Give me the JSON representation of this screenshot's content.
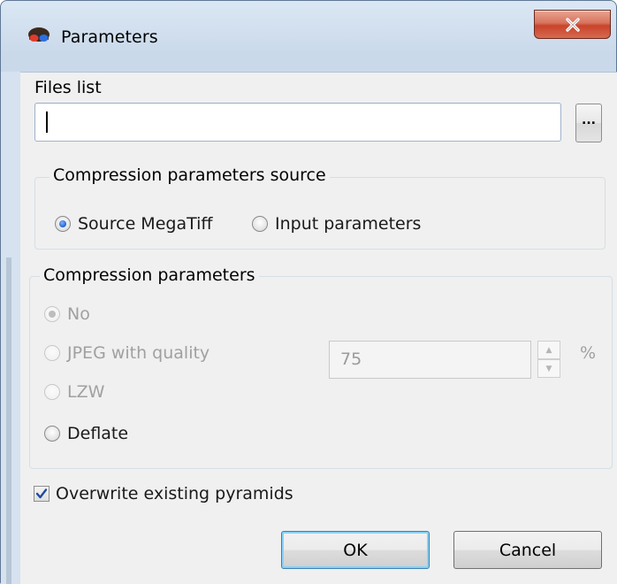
{
  "window": {
    "title": "Parameters",
    "app_icon": "3d-glasses-icon",
    "close_icon": "close-icon"
  },
  "files": {
    "label": "Files list",
    "value": "",
    "browse_label": "..."
  },
  "source_group": {
    "title": "Compression parameters source",
    "options": [
      {
        "label": "Source MegaTiff",
        "selected": true
      },
      {
        "label": "Input parameters",
        "selected": false
      }
    ]
  },
  "compression_group": {
    "title": "Compression parameters",
    "options": [
      {
        "label": "No",
        "selected": true,
        "enabled": false
      },
      {
        "label": "JPEG with quality",
        "selected": false,
        "enabled": false
      },
      {
        "label": "LZW",
        "selected": false,
        "enabled": false
      },
      {
        "label": "Deflate",
        "selected": false,
        "enabled": true
      }
    ],
    "quality_value": "75",
    "quality_unit": "%"
  },
  "overwrite": {
    "label": "Overwrite existing pyramids",
    "checked": true
  },
  "buttons": {
    "ok": "OK",
    "cancel": "Cancel"
  },
  "colors": {
    "titlebar": "#cad9ea",
    "close_button": "#c8432a",
    "client_bg": "#f0f0f0",
    "radio_accent": "#2a6ed6",
    "ok_focus": "#3c7fb1"
  }
}
